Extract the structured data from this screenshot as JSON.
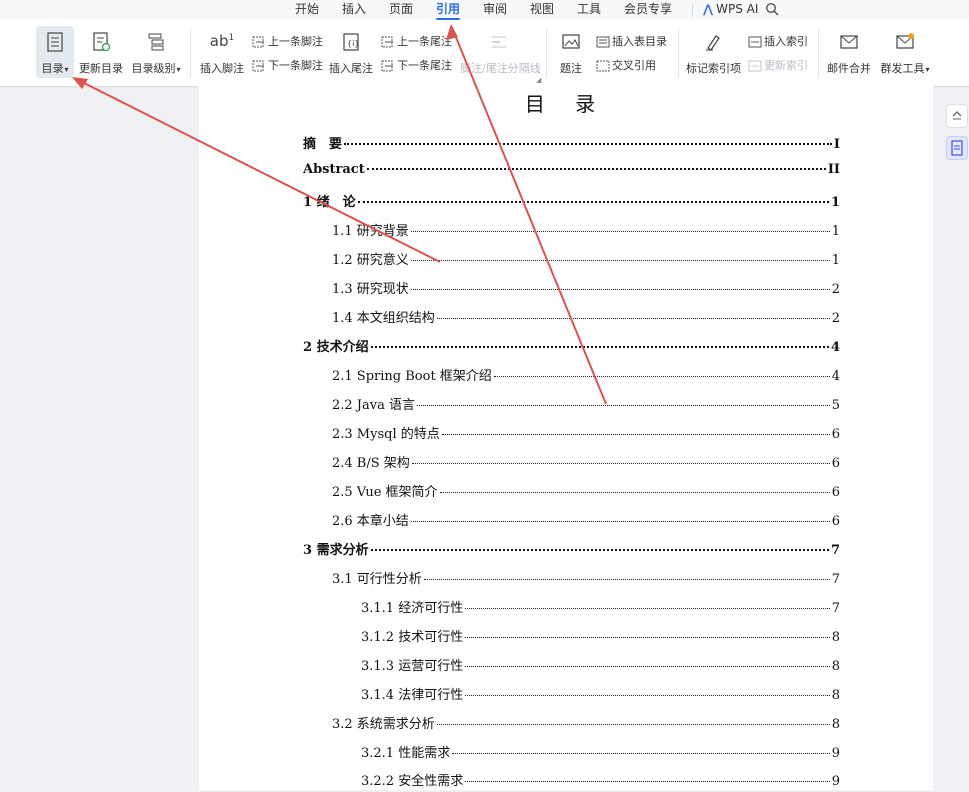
{
  "menu": {
    "tabs": [
      {
        "label": "开始"
      },
      {
        "label": "插入"
      },
      {
        "label": "页面"
      },
      {
        "label": "引用"
      },
      {
        "label": "审阅"
      },
      {
        "label": "视图"
      },
      {
        "label": "工具"
      },
      {
        "label": "会员专享"
      }
    ],
    "active_tab": "引用",
    "wps_ai": "WPS AI"
  },
  "ribbon": {
    "toc": "目录",
    "update_toc": "更新目录",
    "toc_level": "目录级别",
    "insert_footnote": "插入脚注",
    "prev_footnote": "上一条脚注",
    "next_footnote": "下一条脚注",
    "insert_endnote": "插入尾注",
    "prev_endnote": "上一条尾注",
    "next_endnote": "下一条尾注",
    "separator_line": "脚注/尾注分隔线",
    "caption": "题注",
    "insert_table_of_figures": "插入表目录",
    "cross_reference": "交叉引用",
    "mark_index_entry": "标记索引项",
    "insert_index": "插入索引",
    "update_index": "更新索引",
    "mail_merge": "邮件合并",
    "dev_tools": "群发工具"
  },
  "document": {
    "toc_title": "目 录",
    "entries": [
      {
        "text": "摘　要",
        "page": "I"
      },
      {
        "text": "Abstract",
        "page": "II"
      },
      {
        "text": "1 绪　论",
        "page": "1"
      },
      {
        "text": "1.1 研究背景",
        "page": "1"
      },
      {
        "text": "1.2  研究意义",
        "page": "1"
      },
      {
        "text": "1.3  研究现状",
        "page": "2"
      },
      {
        "text": "1.4 本文组织结构",
        "page": "2"
      },
      {
        "text": "2  技术介绍",
        "page": "4"
      },
      {
        "text": "2.1 Spring Boot 框架介绍",
        "page": "4"
      },
      {
        "text": "2.2 Java 语言",
        "page": "5"
      },
      {
        "text": "2.3 Mysql 的特点",
        "page": "6"
      },
      {
        "text": "2.4 B/S 架构",
        "page": "6"
      },
      {
        "text": "2.5 Vue 框架简介",
        "page": "6"
      },
      {
        "text": "2.6 本章小结",
        "page": "6"
      },
      {
        "text": "3 需求分析",
        "page": "7"
      },
      {
        "text": "3.1 可行性分析",
        "page": "7"
      },
      {
        "text": "3.1.1 经济可行性",
        "page": "7"
      },
      {
        "text": "3.1.2 技术可行性",
        "page": "8"
      },
      {
        "text": "3.1.3 运营可行性",
        "page": "8"
      },
      {
        "text": "3.1.4 法律可行性",
        "page": "8"
      },
      {
        "text": "3.2 系统需求分析",
        "page": "8"
      },
      {
        "text": "3.2.1  性能需求",
        "page": "9"
      },
      {
        "text": "3.2.2  安全性需求",
        "page": "9"
      }
    ]
  },
  "colors": {
    "accent": "#2f6fe0",
    "annotation_arrow": "#d9534f"
  }
}
